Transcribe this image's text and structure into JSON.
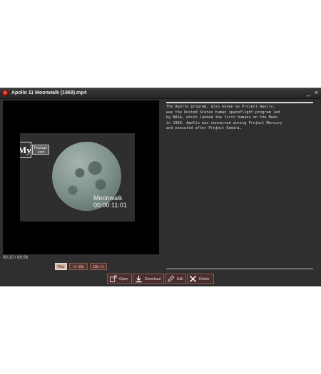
{
  "window": {
    "title": "Apollo 11 Moonwalk (1969).mp4",
    "minimize_glyph": "_",
    "close_glyph": "×"
  },
  "video": {
    "logo_text": "My",
    "logo_subtext": "Footage .com",
    "overlay_title": "Moonwalk",
    "overlay_time": "00:00:11:01",
    "time_readout": "00:10 / 08:56"
  },
  "controls": {
    "play_label": "Play",
    "back_label": "<< 10s",
    "forward_label": "10s >>"
  },
  "description": {
    "text": "The Apollo program, also known as Project Apollo,\nwas the United States human spaceflight program led\nby NASA, which landed the first humans on the Moon\nin 1969. Apollo was conceived during Project Mercury\nand executed after Project Gemini."
  },
  "actions": {
    "open_label": "Open",
    "download_label": "Download",
    "edit_label": "Edit",
    "delete_label": "Delete"
  },
  "icons": {
    "app": "app-logo-icon",
    "open": "open-external-icon",
    "download": "download-icon",
    "edit": "pencil-icon",
    "delete": "x-icon"
  },
  "colors": {
    "window_bg": "#2f2f2f",
    "button_bg": "#4a2e2e",
    "button_border": "#8a5a55",
    "app_icon": "#d8261c"
  }
}
